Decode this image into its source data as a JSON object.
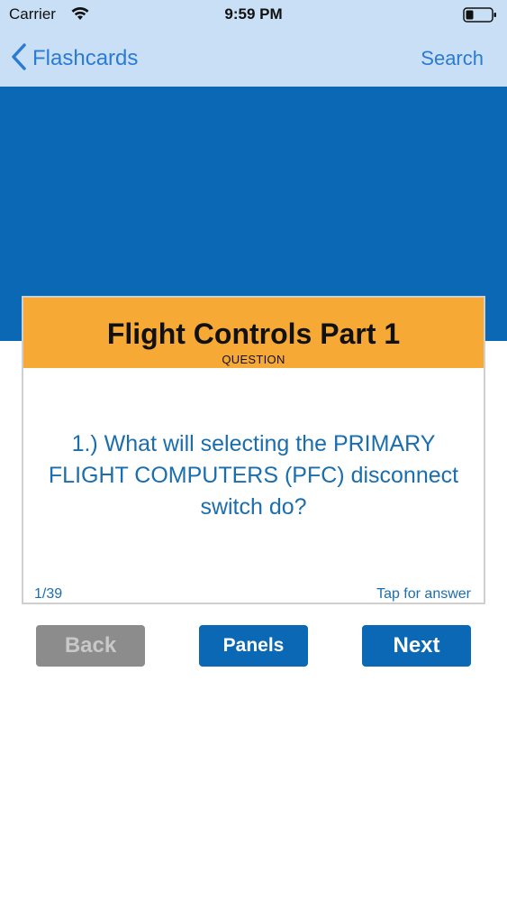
{
  "status_bar": {
    "carrier": "Carrier",
    "time": "9:59 PM",
    "wifi_icon": "wifi-icon",
    "battery_icon": "battery-icon"
  },
  "nav": {
    "back_label": "Flashcards",
    "back_icon": "chevron-left-icon",
    "search_label": "Search",
    "accent_color": "#2b7bd3"
  },
  "card": {
    "title": "Flight Controls Part 1",
    "subtitle": "QUESTION",
    "question": "1.) What will selecting the PRIMARY FLIGHT COMPUTERS (PFC) disconnect switch do?",
    "counter": "1/39",
    "tap_hint": "Tap for answer",
    "header_color": "#f7a935",
    "text_color": "#1b6eae"
  },
  "buttons": {
    "back": "Back",
    "panels": "Panels",
    "next": "Next"
  },
  "colors": {
    "band": "#0a68b4",
    "header": "#c9dff5",
    "disabled": "#8c8c8c"
  }
}
